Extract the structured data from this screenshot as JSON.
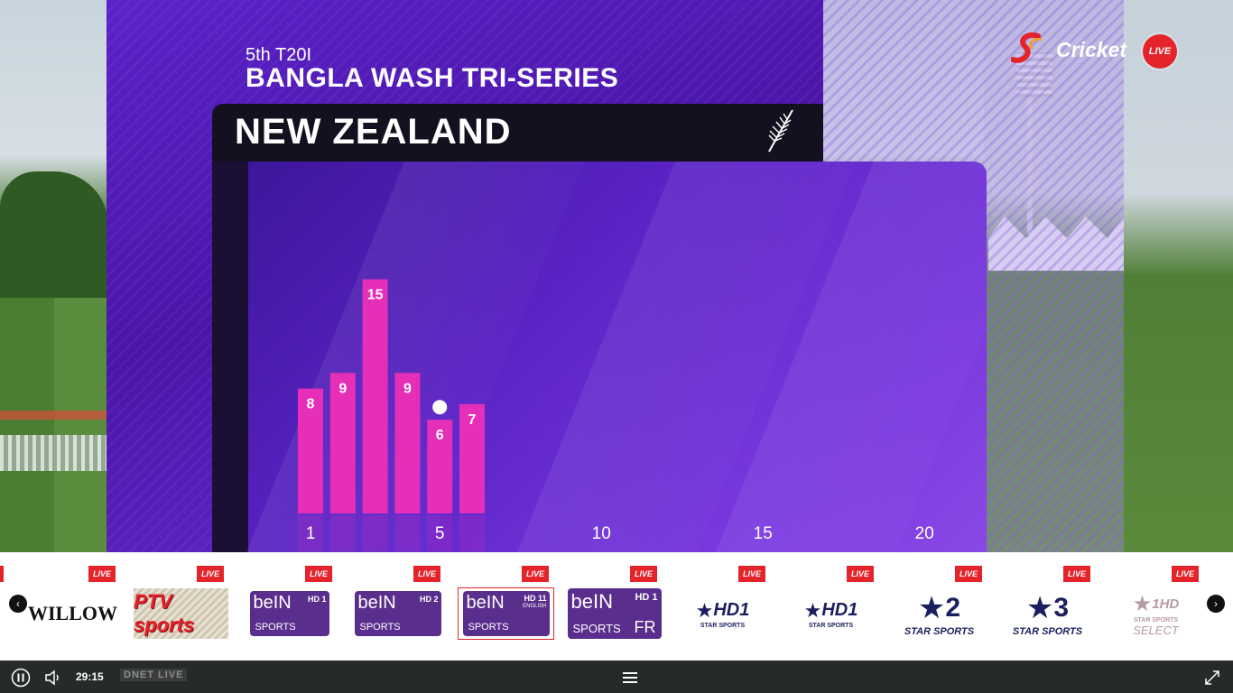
{
  "overlay": {
    "series_sub": "5th T20I",
    "series_title": "BANGLA WASH TRI-SERIES",
    "team": "NEW ZEALAND",
    "brand_text": "Cricket",
    "live_badge": "LIVE"
  },
  "chart_data": {
    "type": "bar",
    "x": [
      1,
      2,
      3,
      4,
      5,
      6
    ],
    "values": [
      8,
      9,
      15,
      9,
      6,
      7
    ],
    "wicket_overs": [
      5
    ],
    "x_ticks": [
      "1",
      "5",
      "10",
      "15",
      "20"
    ],
    "xlim": [
      0,
      20
    ],
    "ylim": [
      0,
      20
    ],
    "colors": {
      "bar": "#e52fb8",
      "bar_top": "#f246cb",
      "wicket": "#ffffff"
    }
  },
  "channels": {
    "live_label": "LIVE",
    "items": [
      {
        "name": "willow",
        "text": "WILLOW"
      },
      {
        "name": "ptv-sports",
        "text": "PTV sports"
      },
      {
        "name": "bein-sports-hd1",
        "text": "beIN",
        "tag": "HD 1",
        "sub": "SPORTS"
      },
      {
        "name": "bein-sports-hd2",
        "text": "beIN",
        "tag": "HD 2",
        "sub": "SPORTS"
      },
      {
        "name": "bein-sports-hd11",
        "text": "beIN",
        "tag": "HD 11",
        "tag2": "ENGLISH",
        "sub": "SPORTS"
      },
      {
        "name": "bein-sports-hd1-fr",
        "text": "beIN",
        "tag": "HD 1",
        "sub": "SPORTS",
        "sub2": "FR"
      },
      {
        "name": "star-sports-hd1-a",
        "text": "HD1",
        "sub": "STAR SPORTS"
      },
      {
        "name": "star-sports-hd1-b",
        "text": "HD1",
        "sub": "STAR SPORTS"
      },
      {
        "name": "star-sports-2",
        "text": "2",
        "sub": "STAR SPORTS"
      },
      {
        "name": "star-sports-3",
        "text": "3",
        "sub": "STAR SPORTS"
      },
      {
        "name": "star-sports-select-1hd",
        "text": "1HD",
        "sub": "STAR SPORTS",
        "sub2": "SELECT"
      }
    ]
  },
  "player": {
    "time": "29:15",
    "watermark": "DNET LIVE"
  }
}
